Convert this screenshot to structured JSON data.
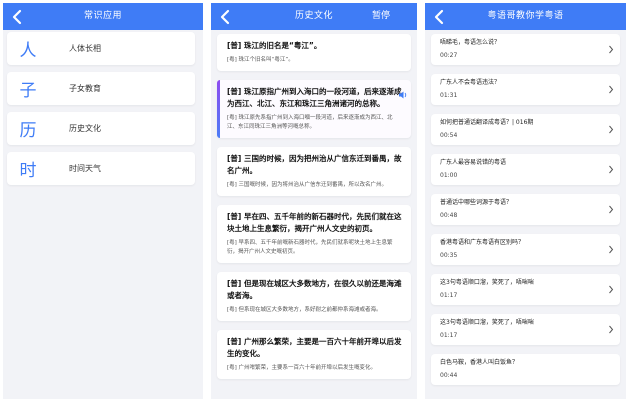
{
  "colors": {
    "accent": "#3f7cf6",
    "active_accent": "#8e4bf0",
    "background": "#f2f3f7"
  },
  "screen1": {
    "title": "常识应用",
    "categories": [
      {
        "char": "人",
        "label": "人体长相"
      },
      {
        "char": "子",
        "label": "子女教育"
      },
      {
        "char": "历",
        "label": "历史文化"
      },
      {
        "char": "时",
        "label": "时间天气"
      }
    ]
  },
  "screen2": {
    "title": "历史文化",
    "pause_label": "暂停",
    "cards": [
      {
        "mandarin": "[普] 珠江的旧名是“粤江”。",
        "cantonese": "[粤] 珠江个旧名叫“粤江”。"
      },
      {
        "mandarin": "[普] 珠江原指广州到入海口的一段河道，后来逐渐成为西江、北江、东江和珠江三角洲诸河的总称。",
        "cantonese": "[粤] 珠江原先系指广州到入海口嗰一段河道，后来逐渐成为西江、北江、东江同珠江三角洲等河嘅总称。"
      },
      {
        "mandarin": "[普] 三国的时候，因为把州治从广信东迁到番禺，故名广州。",
        "cantonese": "[粤] 三国嘅时候，因为将州治从广信东迁到番禺，所以改名广州。"
      },
      {
        "mandarin": "[普] 早在四、五千年前的新石器时代，先民们就在这块土地上生息繁衍，揭开广州人文史的初页。",
        "cantonese": "[粤] 早系四、五千年前嘅新石器时代，先民们就系呢块土地上生息繁衍，揭开广州人文史嘅初页。"
      },
      {
        "mandarin": "[普] 但是现在城区大多数地方，在很久以前还是海滩或者海。",
        "cantonese": "[粤] 但系现在城区大多数地方，系好耐之前都仲系海滩或者海。"
      },
      {
        "mandarin": "[普] 广州那么繁荣，主要是一百六十年前开埠以后发生的变化。",
        "cantonese": "[粤] 广州咁繁荣，主要系一百六十年前开埠以后发生嘅变化。"
      }
    ]
  },
  "screen3": {
    "title": "粤语哥教你学粤语",
    "lessons": [
      {
        "title": "唔睇毛，粤语怎么说？",
        "time": "00:27"
      },
      {
        "title": "广东人不会粤语违法？",
        "time": "01:31"
      },
      {
        "title": "如何把普通话翻译成粤语？| 016期",
        "time": "00:54"
      },
      {
        "title": "广东人最容易说错的粤语",
        "time": "01:00"
      },
      {
        "title": "普通话中哪些词源于粤语？",
        "time": "00:48"
      },
      {
        "title": "香港粤语和广东粤语有区别吗？",
        "time": "00:35"
      },
      {
        "title": "这3句粤语顺口溜，笑死了，唔啱啱",
        "time": "01:17"
      },
      {
        "title": "这3句粤语顺口溜，笑死了，唔啱啱",
        "time": "01:17"
      },
      {
        "title": "白色马鞍，香港人叫白饭鱼？",
        "time": "00:44"
      }
    ]
  }
}
